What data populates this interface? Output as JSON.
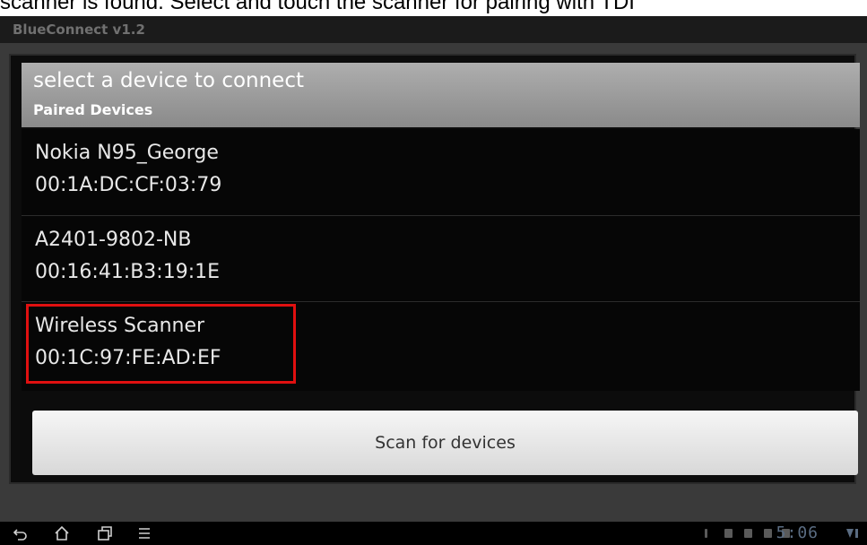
{
  "caption": "scanner is found. Select and touch the scanner for pairing with TDI",
  "app": {
    "title": "BlueConnect v1.2"
  },
  "dialog": {
    "title": "select a device to connect",
    "section_label": "Paired Devices",
    "devices": [
      {
        "name": "Nokia N95_George",
        "address": "00:1A:DC:CF:03:79"
      },
      {
        "name": "A2401-9802-NB",
        "address": "00:16:41:B3:19:1E"
      },
      {
        "name": "Wireless Scanner",
        "address": "00:1C:97:FE:AD:EF",
        "highlighted": true
      }
    ],
    "scan_button_label": "Scan for devices"
  },
  "status_bar": {
    "time": "5:06",
    "icons": [
      "back-icon",
      "home-icon",
      "recent-apps-icon",
      "menu-icon",
      "notification-icon",
      "battery-icon",
      "signal-icon"
    ]
  },
  "colors": {
    "highlight": "#e01010",
    "clock": "#5a6c82"
  }
}
